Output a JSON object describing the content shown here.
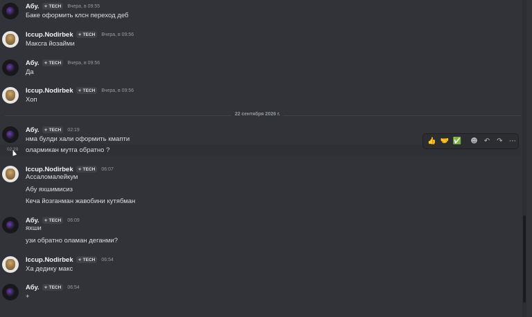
{
  "messages": [
    {
      "author": "Абу.",
      "avatar": "dark",
      "tag": "TECH",
      "time": "Вчера, в 09:55",
      "lines": [
        "Баке оформить клсн переход деб"
      ]
    },
    {
      "author": "Iccup.Nodirbek",
      "avatar": "light",
      "tag": "TECH",
      "time": "Вчера, в 09:56",
      "lines": [
        "Максга йозайми"
      ]
    },
    {
      "author": "Абу.",
      "avatar": "dark",
      "tag": "TECH",
      "time": "Вчера, в 09:56",
      "lines": [
        "Да"
      ]
    },
    {
      "author": "Iccup.Nodirbek",
      "avatar": "light",
      "tag": "TECH",
      "time": "Вчера, в 09:56",
      "lines": [
        "Хоп"
      ]
    },
    {
      "author": "Абу.",
      "avatar": "dark",
      "tag": "TECH",
      "time": "02:19",
      "lines": [
        "нма булди хали оформить кмапти",
        "олармикан мутга обратно ?"
      ]
    },
    {
      "author": "Iccup.Nodirbek",
      "avatar": "light",
      "tag": "TECH",
      "time": "06:07",
      "lines": [
        "Ассаломалейкум",
        "Абу яхшимисиз",
        "Кеча йозганман жавобини кутябман"
      ]
    },
    {
      "author": "Абу.",
      "avatar": "dark",
      "tag": "TECH",
      "time": "06:09",
      "lines": [
        "яхши",
        "узи обратно оламан деганми?"
      ]
    },
    {
      "author": "Iccup.Nodirbek",
      "avatar": "light",
      "tag": "TECH",
      "time": "06:54",
      "lines": [
        "Ха дедику макс"
      ]
    },
    {
      "author": "Абу.",
      "avatar": "dark",
      "tag": "TECH",
      "time": "06:54",
      "lines": [
        "+"
      ]
    }
  ],
  "date_divider": "22 сентября 2026 г.",
  "hover_timestamp": "02:20",
  "tag_icon": "sparkle-icon",
  "actions": {
    "reaction1": "👍",
    "reaction2": "🤝",
    "reaction3": "✅",
    "add_reaction_icon": "☻",
    "reply_icon": "↶",
    "forward_icon": "↷",
    "more_icon": "⋯"
  }
}
